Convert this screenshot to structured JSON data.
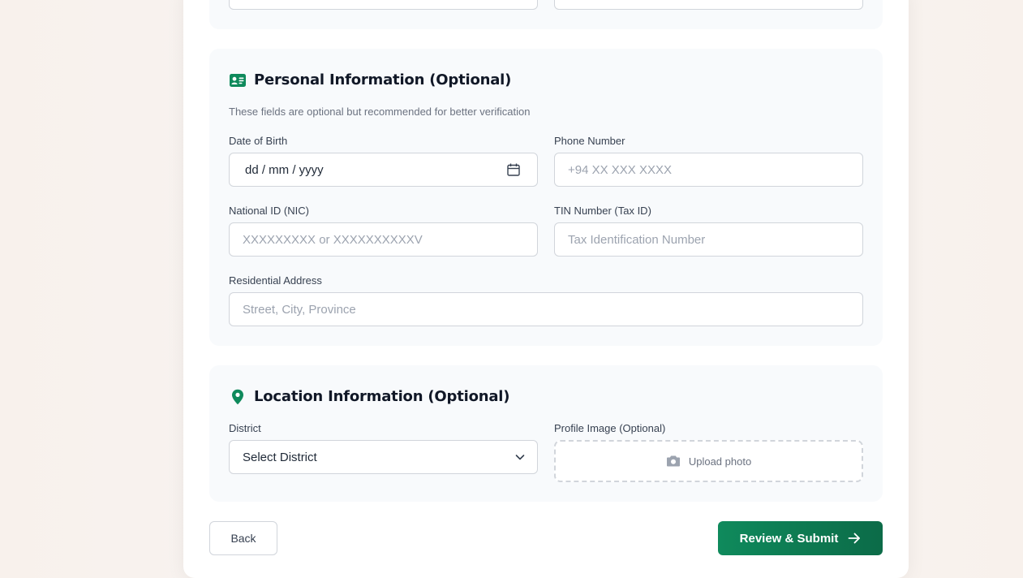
{
  "personal": {
    "title": "Personal Information (Optional)",
    "description": "These fields are optional but recommended for better verification",
    "dob": {
      "label": "Date of Birth",
      "value": "dd / mm / yyyy"
    },
    "phone": {
      "label": "Phone Number",
      "placeholder": "+94 XX XXX XXXX"
    },
    "nic": {
      "label": "National ID (NIC)",
      "placeholder": "XXXXXXXXX or XXXXXXXXXXV"
    },
    "tin": {
      "label": "TIN Number (Tax ID)",
      "placeholder": "Tax Identification Number"
    },
    "address": {
      "label": "Residential Address",
      "placeholder": "Street, City, Province"
    }
  },
  "location": {
    "title": "Location Information (Optional)",
    "district": {
      "label": "District",
      "selected": "Select District"
    },
    "profile_image": {
      "label": "Profile Image (Optional)",
      "upload_text": "Upload photo"
    }
  },
  "actions": {
    "back_label": "Back",
    "submit_label": "Review & Submit"
  },
  "colors": {
    "accent": "#0f8a5c",
    "accent_dark": "#0c6b48"
  },
  "icons": {
    "personal": "id-card-icon",
    "location": "map-pin-icon",
    "dob": "calendar-icon",
    "district": "chevron-down-icon",
    "upload": "camera-icon",
    "submit": "arrow-right-icon"
  }
}
